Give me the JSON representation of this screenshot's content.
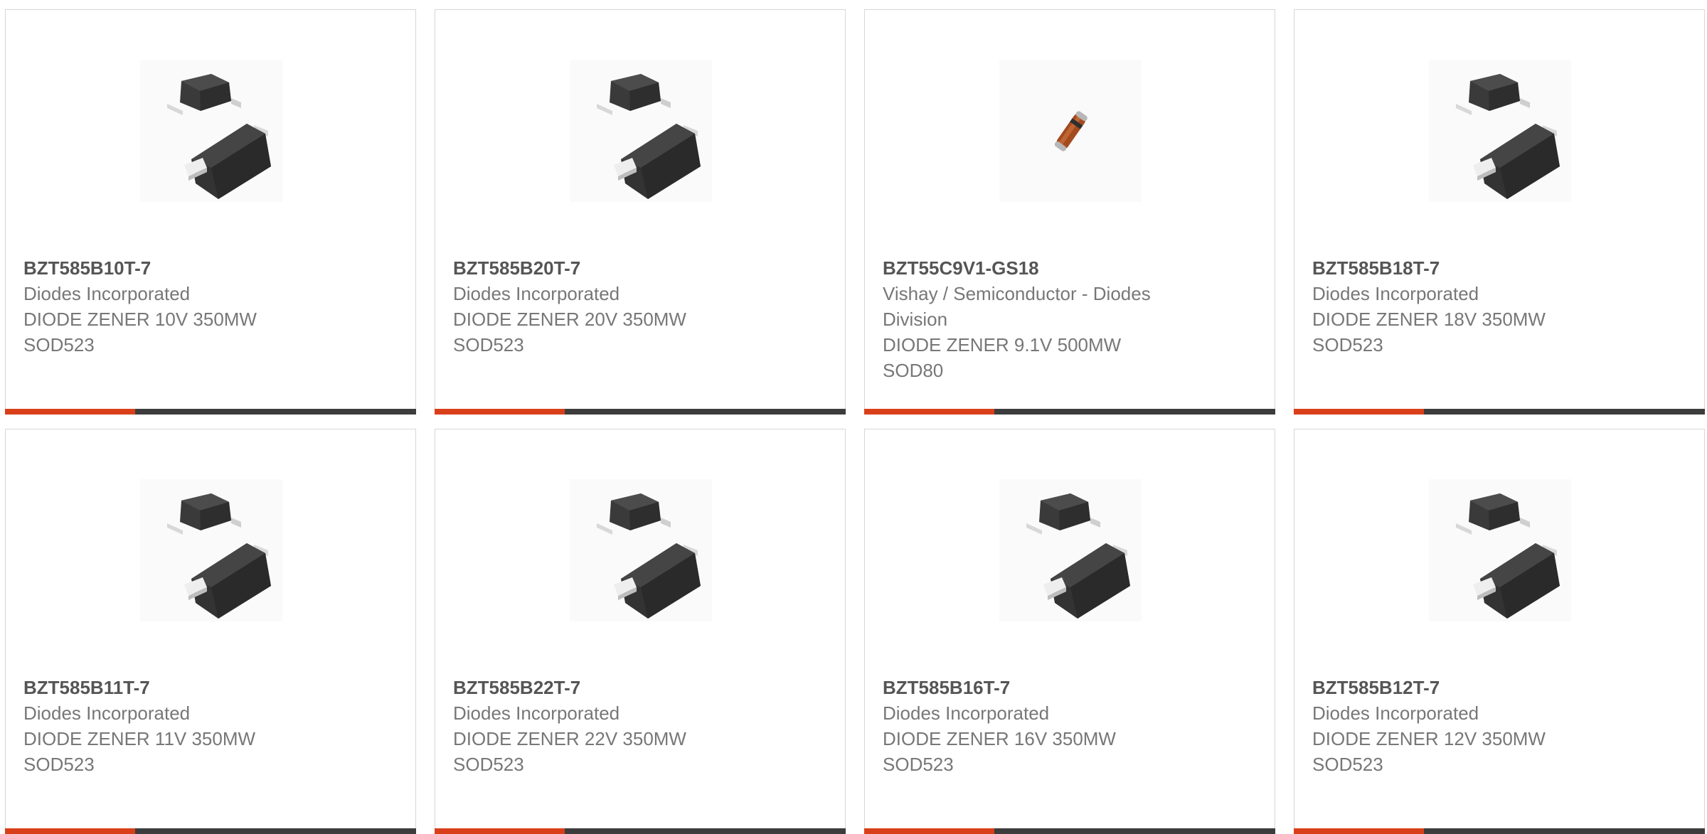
{
  "colors": {
    "accent": "#d9401a",
    "bar": "#3c3c3c",
    "border": "#d7d7d7",
    "text": "#777777",
    "title": "#555555"
  },
  "products": [
    {
      "part_number": "BZT585B10T-7",
      "manufacturer": "Diodes Incorporated",
      "desc_line1": "DIODE ZENER 10V 350MW",
      "desc_line2": "SOD523",
      "image_icon": "sod523-package-icon"
    },
    {
      "part_number": "BZT585B20T-7",
      "manufacturer": "Diodes Incorporated",
      "desc_line1": "DIODE ZENER 20V 350MW",
      "desc_line2": "SOD523",
      "image_icon": "sod523-package-icon"
    },
    {
      "part_number": "BZT55C9V1-GS18",
      "manufacturer": "Vishay / Semiconductor - Diodes Division",
      "desc_line1": "DIODE ZENER 9.1V 500MW",
      "desc_line2": "SOD80",
      "image_icon": "sod80-package-icon"
    },
    {
      "part_number": "BZT585B18T-7",
      "manufacturer": "Diodes Incorporated",
      "desc_line1": "DIODE ZENER 18V 350MW",
      "desc_line2": "SOD523",
      "image_icon": "sod523-package-icon"
    },
    {
      "part_number": "BZT585B11T-7",
      "manufacturer": "Diodes Incorporated",
      "desc_line1": "DIODE ZENER 11V 350MW",
      "desc_line2": "SOD523",
      "image_icon": "sod523-package-icon"
    },
    {
      "part_number": "BZT585B22T-7",
      "manufacturer": "Diodes Incorporated",
      "desc_line1": "DIODE ZENER 22V 350MW",
      "desc_line2": "SOD523",
      "image_icon": "sod523-package-icon"
    },
    {
      "part_number": "BZT585B16T-7",
      "manufacturer": "Diodes Incorporated",
      "desc_line1": "DIODE ZENER 16V 350MW",
      "desc_line2": "SOD523",
      "image_icon": "sod523-package-icon"
    },
    {
      "part_number": "BZT585B12T-7",
      "manufacturer": "Diodes Incorporated",
      "desc_line1": "DIODE ZENER 12V 350MW",
      "desc_line2": "SOD523",
      "image_icon": "sod523-package-icon"
    }
  ]
}
